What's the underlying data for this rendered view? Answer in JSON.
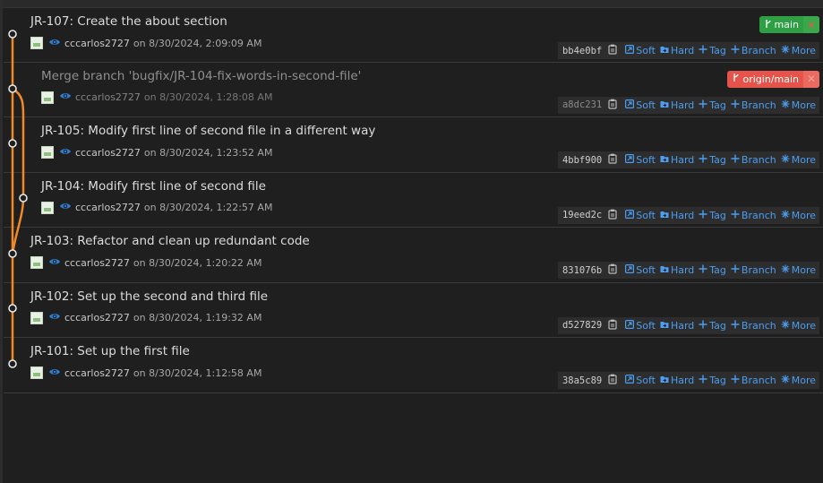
{
  "colors": {
    "graph_line": "#f08a24",
    "link_blue": "#4d9df0",
    "badge_local": "#2ea043",
    "badge_remote": "#e5534b"
  },
  "commits": [
    {
      "title": "JR-107: Create the about section",
      "author": "cccarlos2727",
      "date": "on 8/30/2024, 2:09:09 AM",
      "hash": "bb4e0bf",
      "badge": {
        "label": "main",
        "icon": "branch-icon",
        "close": "✕",
        "kind": "main"
      }
    },
    {
      "title": "Merge branch 'bugfix/JR-104-fix-words-in-second-file'",
      "author": "cccarlos2727",
      "date": "on 8/30/2024, 1:28:08 AM",
      "hash": "a8dc231",
      "dim": true,
      "badge": {
        "label": "origin/main",
        "icon": "branch-icon",
        "close": "✕",
        "kind": "origin"
      }
    },
    {
      "title": "JR-105: Modify first line of second file in a different way",
      "author": "cccarlos2727",
      "date": "on 8/30/2024, 1:23:52 AM",
      "hash": "4bbf900"
    },
    {
      "title": "JR-104: Modify first line of second file",
      "author": "cccarlos2727",
      "date": "on 8/30/2024, 1:22:57 AM",
      "hash": "19eed2c"
    },
    {
      "title": "JR-103: Refactor and clean up redundant code",
      "author": "cccarlos2727",
      "date": "on 8/30/2024, 1:20:22 AM",
      "hash": "831076b"
    },
    {
      "title": "JR-102: Set up the second and third file",
      "author": "cccarlos2727",
      "date": "on 8/30/2024, 1:19:32 AM",
      "hash": "d527829"
    },
    {
      "title": "JR-101: Set up the first file",
      "author": "cccarlos2727",
      "date": "on 8/30/2024, 1:12:58 AM",
      "hash": "38a5c89"
    }
  ],
  "actions": {
    "soft": "Soft",
    "hard": "Hard",
    "tag": "Tag",
    "branch": "Branch",
    "more": "More"
  }
}
